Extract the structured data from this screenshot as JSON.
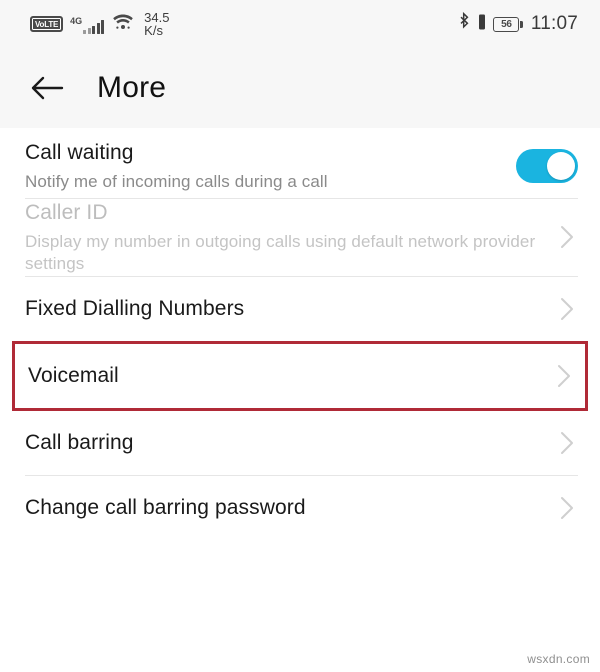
{
  "status_bar": {
    "volte_label": "VoLTE",
    "network_gen": "4G",
    "net_speed_value": "34.5",
    "net_speed_unit": "K/s",
    "battery_percent": "56",
    "time": "11:07",
    "icons": {
      "signal": "signal-bars-icon",
      "wifi": "wifi-icon",
      "bluetooth": "bluetooth-icon",
      "vibrate": "vibrate-icon",
      "battery": "battery-icon"
    }
  },
  "app_bar": {
    "back_icon": "back-arrow-icon",
    "title": "More"
  },
  "settings": {
    "items": [
      {
        "key": "call-waiting",
        "title": "Call waiting",
        "subtitle": "Notify me of incoming calls during a call",
        "control": "toggle",
        "toggle_on": true,
        "disabled": false,
        "highlighted": false
      },
      {
        "key": "caller-id",
        "title": "Caller ID",
        "subtitle": "Display my number in outgoing calls using default network provider settings",
        "control": "chevron",
        "disabled": true,
        "highlighted": false
      },
      {
        "key": "fixed-dialling-numbers",
        "title": "Fixed Dialling Numbers",
        "subtitle": "",
        "control": "chevron",
        "disabled": false,
        "highlighted": false
      },
      {
        "key": "voicemail",
        "title": "Voicemail",
        "subtitle": "",
        "control": "chevron",
        "disabled": false,
        "highlighted": true
      },
      {
        "key": "call-barring",
        "title": "Call barring",
        "subtitle": "",
        "control": "chevron",
        "disabled": false,
        "highlighted": false
      },
      {
        "key": "change-call-barring-password",
        "title": "Change call barring password",
        "subtitle": "",
        "control": "chevron",
        "disabled": false,
        "highlighted": false
      }
    ]
  },
  "colors": {
    "toggle_on": "#1ab4e0",
    "highlight_border": "#b02a37",
    "header_bg": "#f7f7f7",
    "divider": "#e6e6e6"
  },
  "watermark": "wsxdn.com"
}
